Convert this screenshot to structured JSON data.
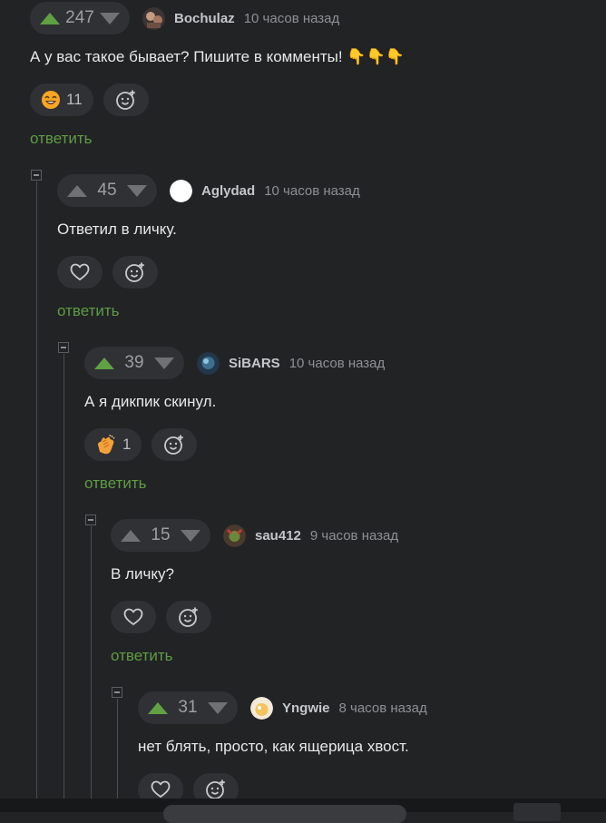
{
  "comments": [
    {
      "score": "247",
      "author": "Bochulaz",
      "time": "10 часов назад",
      "text": "А у вас такое бывает? Пишите в комменты! 👇👇👇",
      "reaction_count": "11",
      "reply": "ответить"
    },
    {
      "score": "45",
      "author": "Aglydad",
      "time": "10 часов назад",
      "text": "Ответил в личку.",
      "reply": "ответить"
    },
    {
      "score": "39",
      "author": "SiBARS",
      "time": "10 часов назад",
      "text": "А я дикпик скинул.",
      "reaction_count": "1",
      "reply": "ответить"
    },
    {
      "score": "15",
      "author": "sau412",
      "time": "9 часов назад",
      "text": "В личку?",
      "reply": "ответить"
    },
    {
      "score": "31",
      "author": "Yngwie",
      "time": "8 часов назад",
      "text": "нет блять, просто, как ящерица хвост."
    }
  ],
  "colors": {
    "background": "#222325",
    "upvote_active": "#5fa143",
    "reply_link": "#5e9c43",
    "pill": "#303134"
  },
  "icons": {
    "upvote": "upvote-arrow-icon",
    "downvote": "downvote-arrow-icon",
    "like": "heart-icon",
    "add_reaction": "add-emoji-icon",
    "collapse": "collapse-minus-icon"
  }
}
